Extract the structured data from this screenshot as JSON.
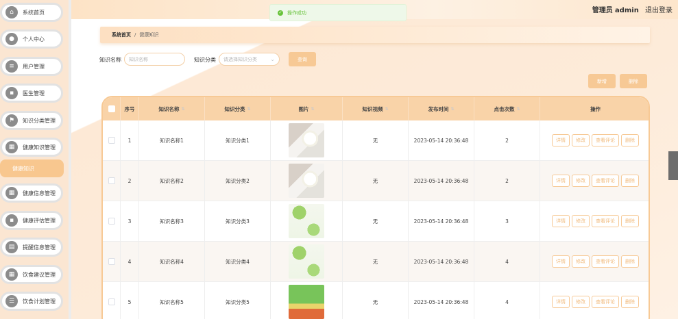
{
  "sidebar": {
    "items": [
      {
        "label": "系统首页",
        "icon": "home-icon",
        "glyph": "⌂"
      },
      {
        "label": "个人中心",
        "icon": "user-icon",
        "glyph": "●"
      },
      {
        "label": "用户管理",
        "icon": "list-icon",
        "glyph": "≡"
      },
      {
        "label": "医生管理",
        "icon": "chat-icon",
        "glyph": "▪"
      },
      {
        "label": "知识分类管理",
        "icon": "flag-icon",
        "glyph": "⚑"
      },
      {
        "label": "健康知识管理",
        "icon": "grid-icon",
        "glyph": "▦"
      },
      {
        "label": "健康信息管理",
        "icon": "grid-icon",
        "glyph": "▦"
      },
      {
        "label": "健康评估管理",
        "icon": "chat-icon",
        "glyph": "▪"
      },
      {
        "label": "提醒信息管理",
        "icon": "doc-icon",
        "glyph": "▤"
      },
      {
        "label": "饮食建议管理",
        "icon": "grid-icon",
        "glyph": "▦"
      },
      {
        "label": "饮食计划管理",
        "icon": "sliders-icon",
        "glyph": "☰"
      }
    ],
    "active_submenu": "健康知识"
  },
  "header": {
    "role": "管理员",
    "username": "admin",
    "logout": "退出登录",
    "toast": "操作成功"
  },
  "breadcrumb": {
    "home": "系统首页",
    "separator": "/",
    "current": "健康知识"
  },
  "search": {
    "name_label": "知识名称",
    "name_placeholder": "知识名称",
    "category_label": "知识分类",
    "category_placeholder": "请选择知识分类",
    "query_button": "查询"
  },
  "toolbar": {
    "add": "新增",
    "delete": "删除"
  },
  "table": {
    "columns": [
      "序号",
      "知识名称",
      "知识分类",
      "图片",
      "知识视频",
      "发布时间",
      "点击次数",
      "操作"
    ],
    "actions": [
      "详情",
      "修改",
      "查看评论",
      "删除"
    ],
    "rows": [
      {
        "index": "1",
        "name": "知识名称1",
        "category": "知识分类1",
        "image": "tea",
        "video": "无",
        "time": "2023-05-14 20:36:48",
        "clicks": "2"
      },
      {
        "index": "2",
        "name": "知识名称2",
        "category": "知识分类2",
        "image": "tea",
        "video": "无",
        "time": "2023-05-14 20:36:48",
        "clicks": "2"
      },
      {
        "index": "3",
        "name": "知识名称3",
        "category": "知识分类3",
        "image": "veg",
        "video": "无",
        "time": "2023-05-14 20:36:48",
        "clicks": "3"
      },
      {
        "index": "4",
        "name": "知识名称4",
        "category": "知识分类4",
        "image": "veg",
        "video": "无",
        "time": "2023-05-14 20:36:48",
        "clicks": "4"
      },
      {
        "index": "5",
        "name": "知识名称5",
        "category": "知识分类5",
        "image": "green",
        "video": "无",
        "time": "2023-05-14 20:36:48",
        "clicks": "4"
      }
    ]
  },
  "colors": {
    "accent": "#f7c995",
    "sidebar_bg": "#fbe6d2",
    "success": "#67c23a"
  }
}
